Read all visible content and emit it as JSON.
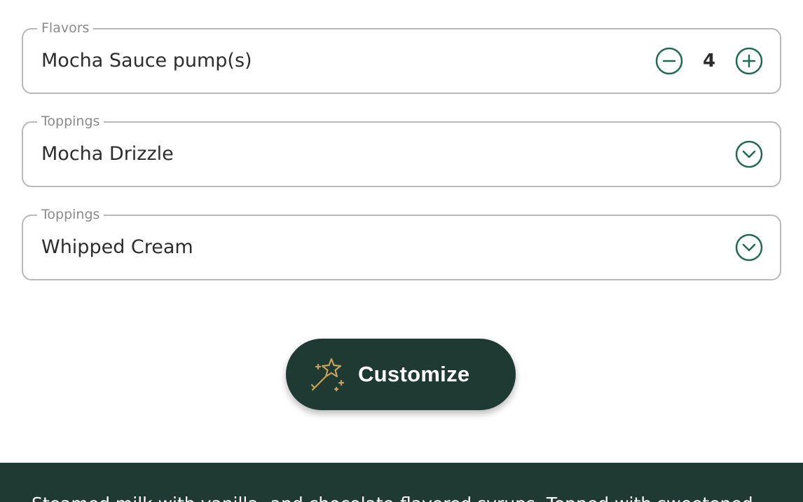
{
  "fields": [
    {
      "legend": "Flavors",
      "value": "Mocha Sauce pump(s)",
      "quantity": "4"
    },
    {
      "legend": "Toppings",
      "value": "Mocha Drizzle"
    },
    {
      "legend": "Toppings",
      "value": "Whipped Cream"
    }
  ],
  "customize": {
    "label": "Customize"
  },
  "description": {
    "text": "Steamed milk with vanilla- and chocolate-flavored syrups. Topped with sweetened"
  },
  "colors": {
    "accent": "#1f6b52",
    "primary_dark": "#1f3a32",
    "gold": "#c8a25a"
  },
  "icons": {
    "decrement": "minus-circle-icon",
    "increment": "plus-circle-icon",
    "dropdown": "chevron-down-circle-icon",
    "customize": "magic-wand-sparkle-icon"
  }
}
